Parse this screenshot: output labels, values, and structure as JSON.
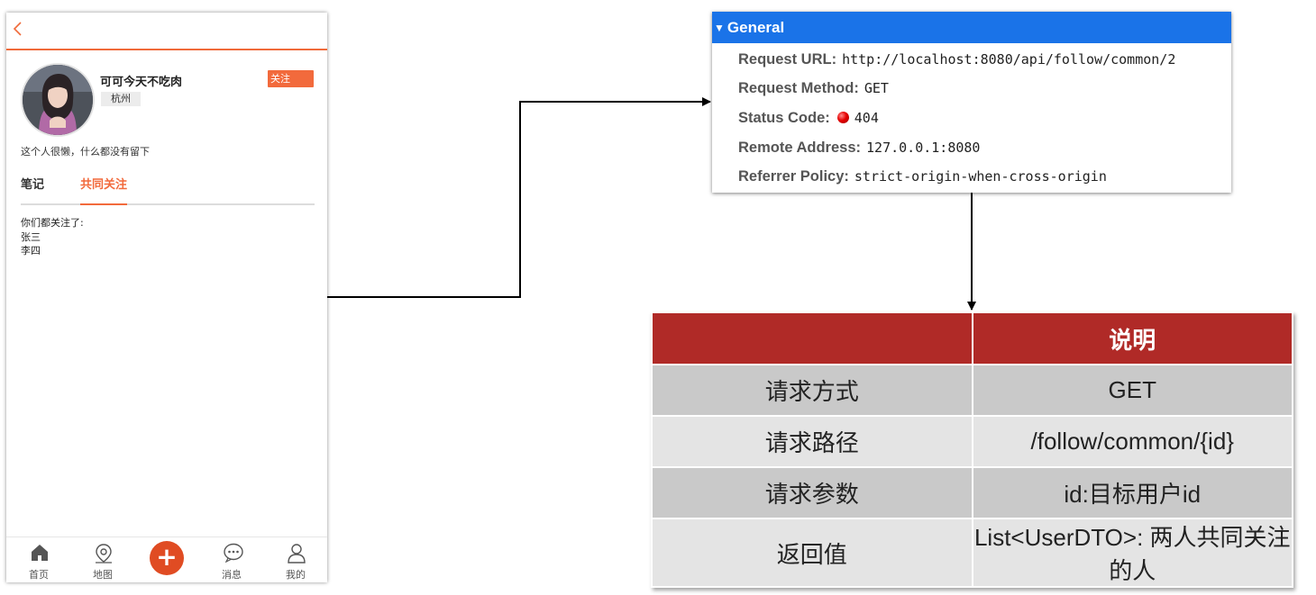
{
  "phone": {
    "nickname": "可可今天不吃肉",
    "city": "杭州",
    "follow_button": "关注",
    "intro": "这个人很懒，什么都没有留下",
    "tabs": [
      {
        "label": "笔记",
        "active": false
      },
      {
        "label": "共同关注",
        "active": true
      }
    ],
    "common_follows": {
      "heading": "你们都关注了:",
      "users": [
        "张三",
        "李四"
      ]
    },
    "tabbar": [
      {
        "label": "首页",
        "icon": "home-icon"
      },
      {
        "label": "地图",
        "icon": "map-pin-icon"
      },
      {
        "label": "",
        "icon": "plus-icon"
      },
      {
        "label": "消息",
        "icon": "message-icon"
      },
      {
        "label": "我的",
        "icon": "user-icon"
      }
    ],
    "accent_color": "#f26a3c"
  },
  "devtools": {
    "section_title": "General",
    "request_url_key": "Request URL:",
    "request_url": "http://localhost:8080/api/follow/common/2",
    "request_method_key": "Request Method:",
    "request_method": "GET",
    "status_code_key": "Status Code:",
    "status_code": "404",
    "remote_address_key": "Remote Address:",
    "remote_address": "127.0.0.1:8080",
    "referrer_policy_key": "Referrer Policy:",
    "referrer_policy": "strict-origin-when-cross-origin",
    "header_color": "#1a73e8"
  },
  "api_table": {
    "header": [
      "",
      "说明"
    ],
    "rows": [
      {
        "key": "请求方式",
        "value": "GET"
      },
      {
        "key": "请求路径",
        "value": "/follow/common/{id}"
      },
      {
        "key": "请求参数",
        "value": "id:目标用户id"
      },
      {
        "key": "返回值",
        "value": "List<UserDTO>: 两人共同关注的人"
      }
    ],
    "header_color": "#b02a27"
  }
}
